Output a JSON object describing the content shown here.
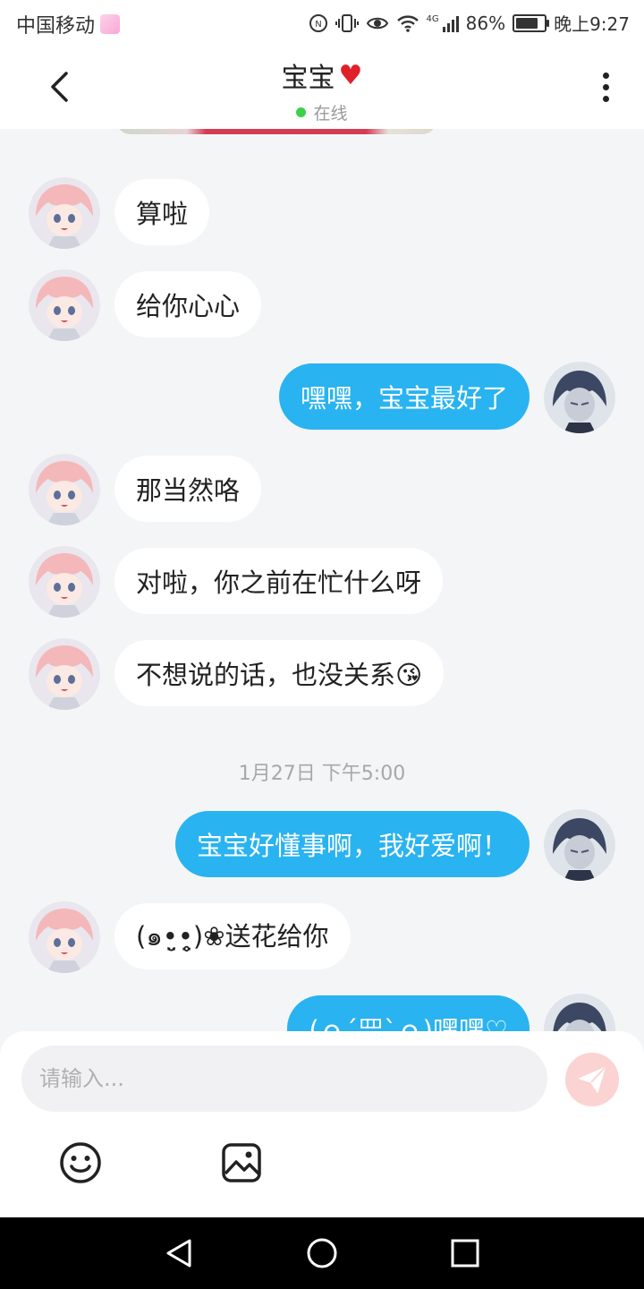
{
  "status_bar": {
    "carrier": "中国移动",
    "network_type": "4G",
    "battery_percent": "86%",
    "battery_level": 0.86,
    "time": "晚上9:27",
    "icons": [
      "nfc-icon",
      "vibrate-icon",
      "eye-icon",
      "wifi-icon",
      "signal-icon",
      "battery-icon"
    ]
  },
  "header": {
    "contact_name": "宝宝",
    "heart_emoji": "❤️",
    "online_status": "在线",
    "back_icon": "chevron-left-icon",
    "more_icon": "more-vertical-icon"
  },
  "messages": [
    {
      "direction": "incoming",
      "text": "算啦"
    },
    {
      "direction": "incoming",
      "text": "给你心心"
    },
    {
      "direction": "outgoing",
      "text": "嘿嘿，宝宝最好了"
    },
    {
      "direction": "incoming",
      "text": "那当然咯"
    },
    {
      "direction": "incoming",
      "text": "对啦，你之前在忙什么呀"
    },
    {
      "direction": "incoming",
      "text": "不想说的话，也没关系😘"
    },
    {
      "direction": "outgoing",
      "text": "宝宝好懂事啊，我好爱啊！"
    },
    {
      "direction": "incoming",
      "text": "(๑•̤̮•̤̥)❀送花给你"
    },
    {
      "direction": "outgoing",
      "text": "(ｏ´罒`ｏ)嘿嘿♡"
    }
  ],
  "timestamp": "1月27日 下午5:00",
  "input": {
    "placeholder": "请输入...",
    "value": ""
  },
  "toolbar": {
    "emoji_icon": "emoji-icon",
    "image_icon": "image-icon",
    "send_icon": "send-icon"
  },
  "colors": {
    "outgoing_bubble": "#29b3f0",
    "incoming_bubble": "#ffffff",
    "background": "#f4f5f7",
    "online_dot": "#3ecf4c",
    "send_button": "#fbd3d3"
  }
}
